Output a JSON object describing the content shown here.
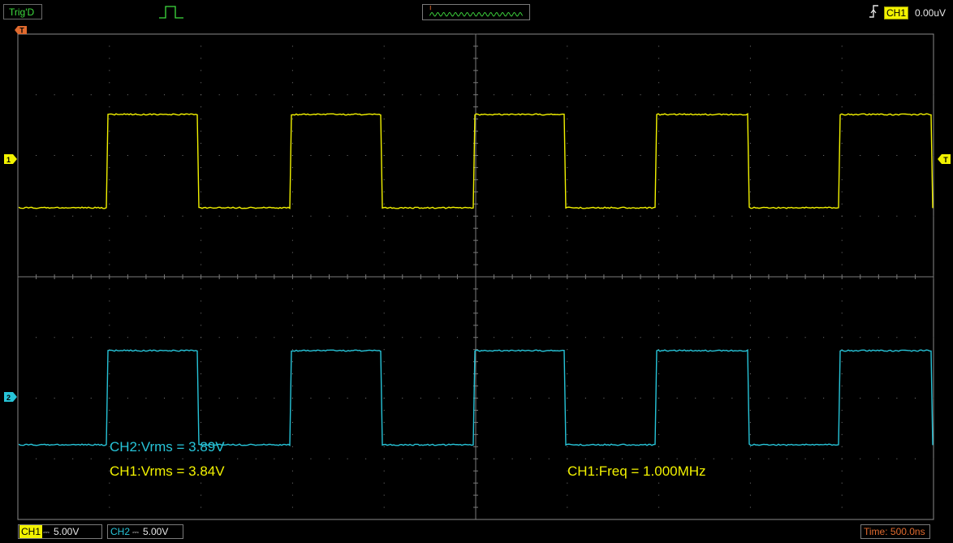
{
  "status": {
    "label": "Trig'D"
  },
  "trigger": {
    "source": "CH1",
    "level": "0.00uV",
    "marker": "T"
  },
  "channels": [
    {
      "id": "1",
      "marker": "1",
      "tag": "CH1",
      "scale": "5.00V",
      "color": "#f2f200"
    },
    {
      "id": "2",
      "marker": "2",
      "tag": "CH2",
      "scale": "5.00V",
      "color": "#27c4d8"
    }
  ],
  "timebase": {
    "label": "Time: 500.0ns"
  },
  "measurements": [
    {
      "text": "CH2:Vrms = 3.89V",
      "color": "#27c4d8"
    },
    {
      "text": "CH1:Vrms = 3.84V",
      "color": "#f2f200"
    },
    {
      "text": "CH1:Freq = 1.000MHz",
      "color": "#f2f200"
    }
  ],
  "colors": {
    "grid": "#7a7a7a",
    "background": "#000000",
    "time_label": "#e06a2e",
    "status": "#3fdc3f"
  },
  "icons": {
    "trigger_edge": "rising-edge-icon",
    "pulse": "pulse-icon"
  }
}
